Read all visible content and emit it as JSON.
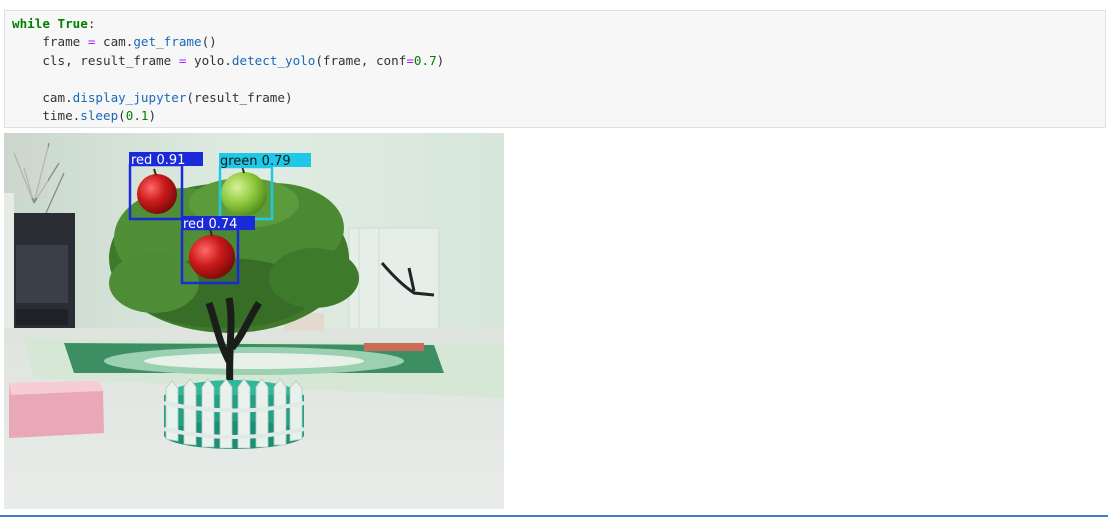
{
  "code_cell": {
    "lines": [
      [
        {
          "t": "while",
          "c": "kw"
        },
        {
          "t": " ",
          "c": "nm"
        },
        {
          "t": "True",
          "c": "kw"
        },
        {
          "t": ":",
          "c": "nm"
        }
      ],
      [
        {
          "t": "    frame ",
          "c": "nm"
        },
        {
          "t": "=",
          "c": "op"
        },
        {
          "t": " cam.",
          "c": "nm"
        },
        {
          "t": "get_frame",
          "c": "fn"
        },
        {
          "t": "()",
          "c": "nm"
        }
      ],
      [
        {
          "t": "    cls, result_frame ",
          "c": "nm"
        },
        {
          "t": "=",
          "c": "op"
        },
        {
          "t": " yolo.",
          "c": "nm"
        },
        {
          "t": "detect_yolo",
          "c": "fn"
        },
        {
          "t": "(frame, conf",
          "c": "nm"
        },
        {
          "t": "=",
          "c": "op"
        },
        {
          "t": "0.7",
          "c": "num"
        },
        {
          "t": ")",
          "c": "nm"
        }
      ],
      [],
      [
        {
          "t": "    cam.",
          "c": "nm"
        },
        {
          "t": "display_jupyter",
          "c": "fn"
        },
        {
          "t": "(result_frame)",
          "c": "nm"
        }
      ],
      [
        {
          "t": "    time.",
          "c": "nm"
        },
        {
          "t": "sleep",
          "c": "fn"
        },
        {
          "t": "(",
          "c": "nm"
        },
        {
          "t": "0.1",
          "c": "num"
        },
        {
          "t": ")",
          "c": "nm"
        }
      ]
    ]
  },
  "output": {
    "detections": [
      {
        "label": "red 0.91",
        "class": "red",
        "color": "#1a2ad8"
      },
      {
        "label": "green 0.79",
        "class": "green",
        "color": "#1ec8e6"
      },
      {
        "label": "red 0.74",
        "class": "red",
        "color": "#1a2ad8"
      }
    ]
  },
  "colors": {
    "cell_background": "#f7f7f7",
    "keyword": "#008000",
    "function": "#1a68b8",
    "operator": "#aa22ff",
    "number": "#008000",
    "bottom_rule": "#3f7fbf"
  }
}
